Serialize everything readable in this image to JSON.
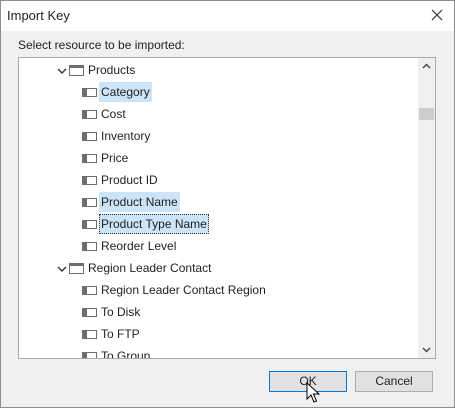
{
  "window": {
    "title": "Import Key"
  },
  "prompt": "Select resource to be imported:",
  "tree": {
    "items": [
      {
        "label": "Products",
        "type": "folder",
        "expanded": true,
        "state": "none"
      },
      {
        "label": "Category",
        "type": "field",
        "state": "selected"
      },
      {
        "label": "Cost",
        "type": "field",
        "state": "none"
      },
      {
        "label": "Inventory",
        "type": "field",
        "state": "none"
      },
      {
        "label": "Price",
        "type": "field",
        "state": "none"
      },
      {
        "label": "Product ID",
        "type": "field",
        "state": "none"
      },
      {
        "label": "Product Name",
        "type": "field",
        "state": "selected"
      },
      {
        "label": "Product Type Name",
        "type": "field",
        "state": "focused"
      },
      {
        "label": "Reorder Level",
        "type": "field",
        "state": "none"
      },
      {
        "label": "Region Leader Contact",
        "type": "folder",
        "expanded": true,
        "state": "none"
      },
      {
        "label": "Region Leader Contact Region",
        "type": "field",
        "state": "none"
      },
      {
        "label": "To Disk",
        "type": "field",
        "state": "none"
      },
      {
        "label": "To FTP",
        "type": "field",
        "state": "none"
      },
      {
        "label": "To Group",
        "type": "field",
        "state": "none"
      }
    ]
  },
  "buttons": {
    "ok": "OK",
    "cancel": "Cancel"
  }
}
